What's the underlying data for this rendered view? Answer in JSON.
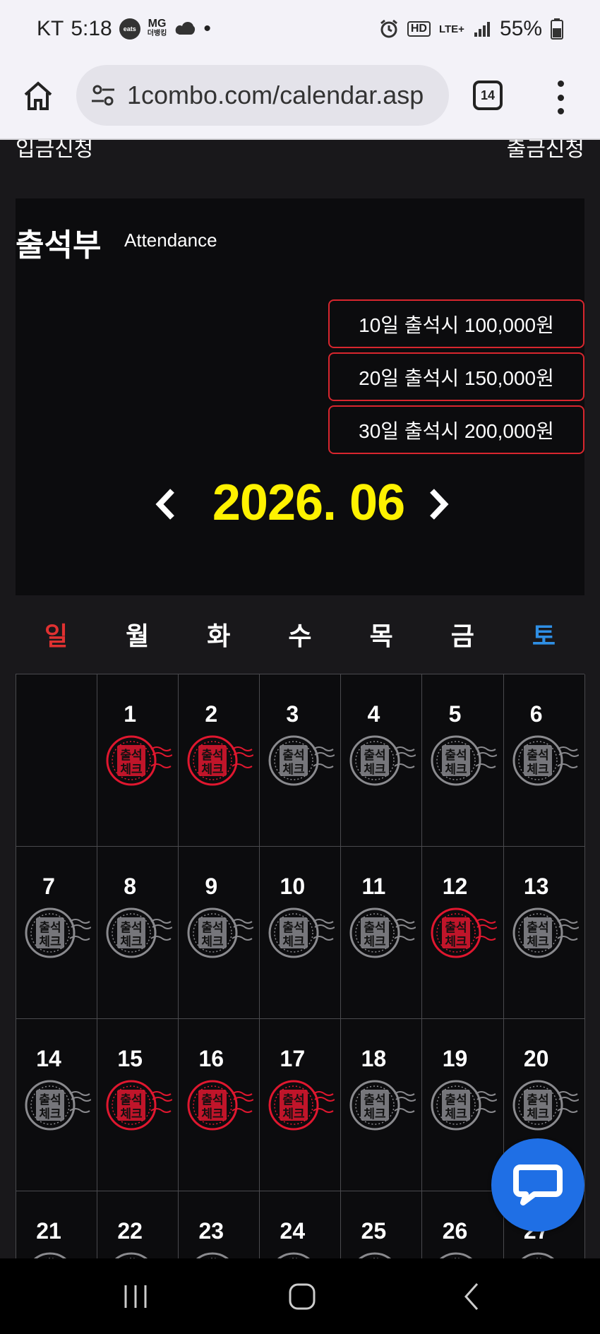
{
  "status_bar": {
    "carrier": "KT",
    "time": "5:18",
    "eats_badge": "eats",
    "mg_label": "MG",
    "mg_sub": "더뱅킹",
    "dot": "•",
    "hd": "HD",
    "network": "LTE+",
    "battery": "55%"
  },
  "browser": {
    "url": "1combo.com/calendar.asp",
    "tab_count": "14"
  },
  "page": {
    "deposit_link": "입금신청",
    "withdraw_link": "출금신청",
    "attendance_title": "출석부",
    "attendance_sub": "Attendance",
    "rewards": [
      "10일 출석시 100,000원",
      "20일 출석시 150,000원",
      "30일 출석시 200,000원"
    ],
    "month": "2026. 06",
    "weekdays": [
      "일",
      "월",
      "화",
      "수",
      "목",
      "금",
      "토"
    ],
    "stamp_text_1": "출석",
    "stamp_text_2": "체크",
    "calendar_days": [
      {
        "day": "",
        "checked": false,
        "empty": true
      },
      {
        "day": "1",
        "checked": true
      },
      {
        "day": "2",
        "checked": true
      },
      {
        "day": "3",
        "checked": false
      },
      {
        "day": "4",
        "checked": false
      },
      {
        "day": "5",
        "checked": false
      },
      {
        "day": "6",
        "checked": false
      },
      {
        "day": "7",
        "checked": false
      },
      {
        "day": "8",
        "checked": false
      },
      {
        "day": "9",
        "checked": false
      },
      {
        "day": "10",
        "checked": false
      },
      {
        "day": "11",
        "checked": false
      },
      {
        "day": "12",
        "checked": true
      },
      {
        "day": "13",
        "checked": false
      },
      {
        "day": "14",
        "checked": false
      },
      {
        "day": "15",
        "checked": true
      },
      {
        "day": "16",
        "checked": true
      },
      {
        "day": "17",
        "checked": true
      },
      {
        "day": "18",
        "checked": false
      },
      {
        "day": "19",
        "checked": false
      },
      {
        "day": "20",
        "checked": false
      },
      {
        "day": "21",
        "checked": false
      },
      {
        "day": "22",
        "checked": false
      },
      {
        "day": "23",
        "checked": false
      },
      {
        "day": "24",
        "checked": false
      },
      {
        "day": "25",
        "checked": false
      },
      {
        "day": "26",
        "checked": false
      },
      {
        "day": "27",
        "checked": false
      }
    ]
  },
  "colors": {
    "checked_stamp": "#e0172f",
    "unchecked_stamp": "#8a8a8e",
    "month": "#fff200",
    "sunday": "#e03131",
    "saturday": "#2f8fe5",
    "reward_border": "#d8262e",
    "chat_button": "#1f6fe5"
  },
  "icons": {
    "home": "home-icon",
    "site_settings": "tune-icon",
    "prev": "chevron-left-icon",
    "next": "chevron-right-icon",
    "chat": "chat-bubble-icon",
    "recents": "recents-icon",
    "home_nav": "home-nav-icon",
    "back": "back-icon"
  }
}
